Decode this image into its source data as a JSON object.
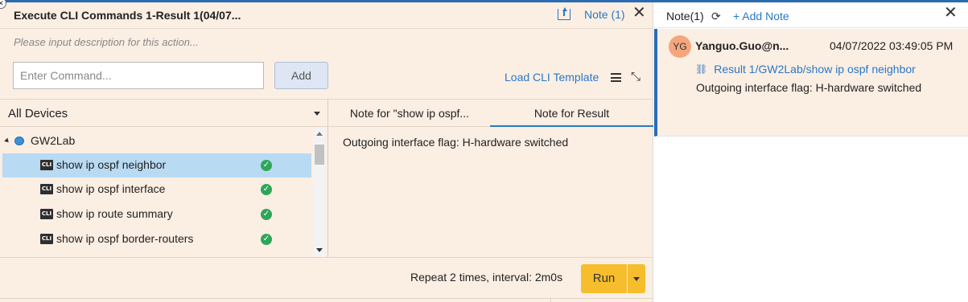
{
  "main": {
    "title": "Execute CLI Commands 1-Result 1(04/07...",
    "note_link": "Note (1)",
    "description_placeholder": "Please input description for this action...",
    "command_placeholder": "Enter Command...",
    "add_label": "Add",
    "load_template": "Load CLI Template"
  },
  "tree": {
    "header": "All Devices",
    "root": "GW2Lab",
    "items": [
      {
        "label": "show ip ospf neighbor",
        "selected": true
      },
      {
        "label": "show ip ospf interface",
        "selected": false
      },
      {
        "label": "show ip route summary",
        "selected": false
      },
      {
        "label": "show ip ospf border-routers",
        "selected": false
      }
    ],
    "cli_badge": "CLI"
  },
  "notes_tabs": {
    "tab1": "Note for \"show ip ospf...",
    "tab2": "Note for Result",
    "active": "tab2",
    "body": "Outgoing interface flag: H-hardware switched"
  },
  "footer": {
    "repeat": "Repeat 2 times, interval: 2m0s",
    "run_label": "Run"
  },
  "side": {
    "count": "Note(1)",
    "add_note": "+ Add Note",
    "note": {
      "avatar": "YG",
      "author": "Yanguo.Guo@n...",
      "timestamp": "04/07/2022 03:49:05 PM",
      "link": "Result 1/GW2Lab/show ip ospf neighbor",
      "text": "Outgoing interface flag: H-hardware switched"
    }
  },
  "colors": {
    "accent": "#2b78c5",
    "panel_bg": "#fbeee3",
    "selected_row": "#b8daf3",
    "run_button": "#f6bd2c",
    "success": "#2fa65a"
  }
}
